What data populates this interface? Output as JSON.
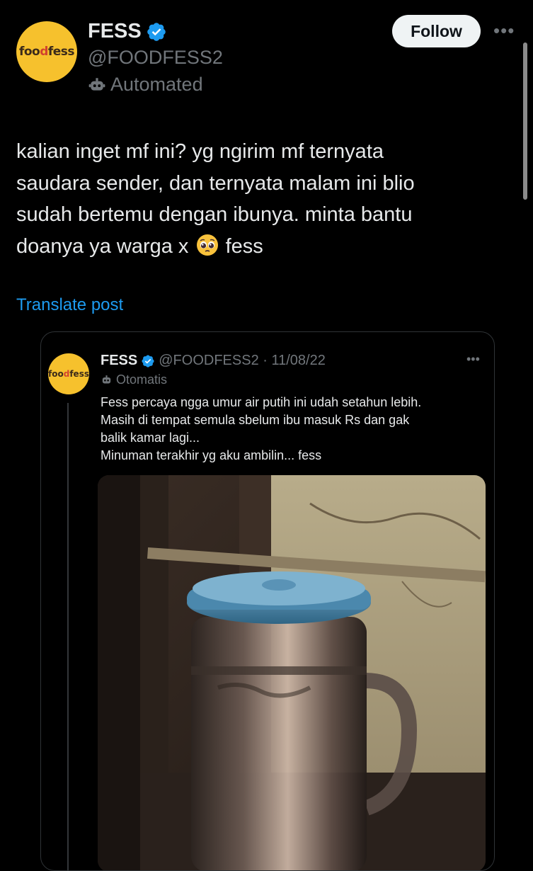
{
  "post": {
    "author_name": "FESS",
    "handle": "@FOODFESS2",
    "label": "Automated",
    "follow_label": "Follow",
    "more_label": "•••",
    "avatar_text": "foodfess",
    "text_line1": "kalian inget mf ini? yg ngirim mf ternyata",
    "text_line2": "saudara sender, dan ternyata malam ini blio",
    "text_line3": "sudah bertemu dengan ibunya. minta bantu",
    "text_line4_before": "doanya ya warga x",
    "text_line4_after": "fess",
    "translate_label": "Translate post"
  },
  "quote": {
    "author_name": "FESS",
    "handle_date": "@FOODFESS2 · 11/08/22",
    "label": "Otomatis",
    "more_label": "•••",
    "avatar_text": "foodfess",
    "line1": "Fess percaya ngga umur air putih ini udah setahun lebih.",
    "line2": "Masih di tempat semula sbelum ibu masuk Rs dan gak",
    "line3": "balik kamar lagi...",
    "line4": "Minuman terakhir yg aku ambilin... fess"
  },
  "icons": {
    "verified": "verified-badge-icon",
    "bot": "robot-icon",
    "emoji": "pleading-face-emoji",
    "more": "more-horizontal-icon"
  },
  "colors": {
    "background": "#000000",
    "text": "#e7e9ea",
    "secondary": "#71767b",
    "link": "#1d9bf0",
    "verified": "#1d9bf0",
    "avatar_bg": "#f6c12d"
  }
}
